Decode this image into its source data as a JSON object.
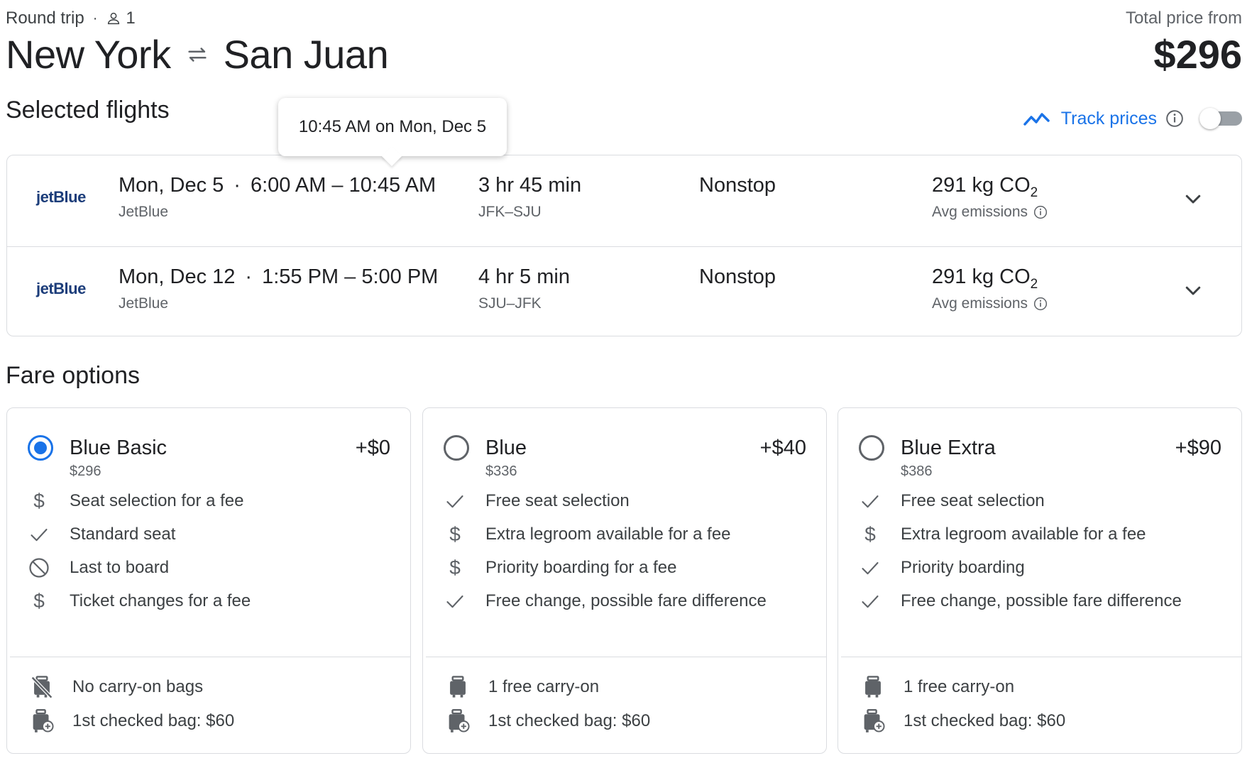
{
  "header": {
    "trip_type": "Round trip",
    "separator": "·",
    "passengers": "1",
    "origin": "New York",
    "destination": "San Juan",
    "price_label": "Total price from",
    "price": "$296"
  },
  "selected": {
    "title": "Selected flights",
    "tooltip": "10:45 AM on Mon, Dec 5",
    "track_label": "Track prices",
    "track_enabled": false
  },
  "flights": [
    {
      "airline_logo": "jetBlue",
      "date": "Mon, Dec 5",
      "times": "6:00 AM – 10:45 AM",
      "airline": "JetBlue",
      "duration": "3 hr 45 min",
      "route": "JFK–SJU",
      "stops": "Nonstop",
      "co2": "291 kg CO",
      "co2_sub": "2",
      "emissions_label": "Avg emissions"
    },
    {
      "airline_logo": "jetBlue",
      "date": "Mon, Dec 12",
      "times": "1:55 PM – 5:00 PM",
      "airline": "JetBlue",
      "duration": "4 hr 5 min",
      "route": "SJU–JFK",
      "stops": "Nonstop",
      "co2": "291 kg CO",
      "co2_sub": "2",
      "emissions_label": "Avg emissions"
    }
  ],
  "fares_title": "Fare options",
  "fares": [
    {
      "name": "Blue Basic",
      "total": "$296",
      "add": "+$0",
      "selected": true,
      "features": [
        {
          "icon": "dollar-icon",
          "text": "Seat selection for a fee"
        },
        {
          "icon": "check-icon",
          "text": "Standard seat"
        },
        {
          "icon": "no-icon",
          "text": "Last to board"
        },
        {
          "icon": "dollar-icon",
          "text": "Ticket changes for a fee"
        }
      ],
      "bags": [
        {
          "icon": "no-carry-on-icon",
          "text": "No carry-on bags"
        },
        {
          "icon": "checked-bag-icon",
          "text": "1st checked bag: $60"
        }
      ]
    },
    {
      "name": "Blue",
      "total": "$336",
      "add": "+$40",
      "selected": false,
      "features": [
        {
          "icon": "check-icon",
          "text": "Free seat selection"
        },
        {
          "icon": "dollar-icon",
          "text": "Extra legroom available for a fee"
        },
        {
          "icon": "dollar-icon",
          "text": "Priority boarding for a fee"
        },
        {
          "icon": "check-icon",
          "text": "Free change, possible fare difference"
        }
      ],
      "bags": [
        {
          "icon": "carry-on-icon",
          "text": "1 free carry-on"
        },
        {
          "icon": "checked-bag-icon",
          "text": "1st checked bag: $60"
        }
      ]
    },
    {
      "name": "Blue Extra",
      "total": "$386",
      "add": "+$90",
      "selected": false,
      "features": [
        {
          "icon": "check-icon",
          "text": "Free seat selection"
        },
        {
          "icon": "dollar-icon",
          "text": "Extra legroom available for a fee"
        },
        {
          "icon": "check-icon",
          "text": "Priority boarding"
        },
        {
          "icon": "check-icon",
          "text": "Free change, possible fare difference"
        }
      ],
      "bags": [
        {
          "icon": "carry-on-icon",
          "text": "1 free carry-on"
        },
        {
          "icon": "checked-bag-icon",
          "text": "1st checked bag: $60"
        }
      ]
    }
  ],
  "colors": {
    "accent": "#1a73e8",
    "airline_logo": "#1c3d7a",
    "border": "#dadce0",
    "muted_text": "#5f6368"
  }
}
